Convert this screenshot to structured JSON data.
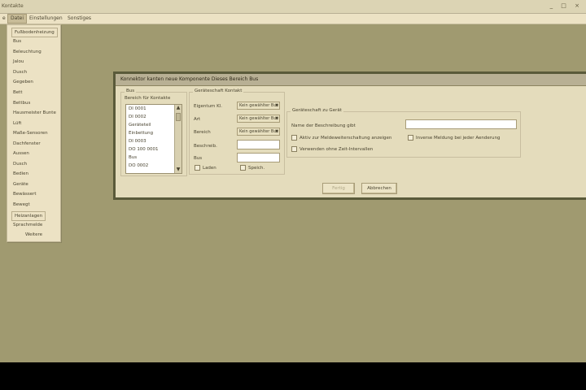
{
  "window": {
    "title": "Kontakte",
    "controls": "_ □ ×"
  },
  "menubar": {
    "items": [
      {
        "label": "e",
        "active": false
      },
      {
        "label": "Datei",
        "active": true
      },
      {
        "label": "Einstellungen",
        "active": false
      },
      {
        "label": "Sonstiges",
        "active": false
      }
    ]
  },
  "dropdown": {
    "items": [
      "Fußbodenheizung",
      "Bus",
      "Beleuchtung",
      "Jalou",
      "Dusch",
      "Gegeben",
      "Bett",
      "Bettbus",
      "Hausmeister Bunte",
      "Lüft",
      "Maße-Sensoren",
      "Dachfenster",
      "Aussen",
      "Dusch",
      "Bedien",
      "Geräte",
      "Bewässert",
      "Bewegt",
      "Heizanlagen",
      "Sprachmelde"
    ],
    "more_label": "Weitere"
  },
  "dialog": {
    "title": "Konnektor kanten neue Komponente Dieses Bereich Bus",
    "list_group": {
      "label": "Bus",
      "sublabel": "Bereich für Kontakte",
      "items": [
        "DI 0001",
        "DI 0002",
        "Geräteteil",
        "Einbettung",
        "DI 0003",
        "DO 100 0001",
        "Bus",
        "DO 0002"
      ]
    },
    "prop_group": {
      "label": "Geräteschaft Kontakt",
      "rows": [
        {
          "label": "Eigentum Kl.",
          "value": "Kein gewählter Bus"
        },
        {
          "label": "Art",
          "value": "Kein gewählter Bus"
        },
        {
          "label": "Bereich",
          "value": "Kein gewählter Bus"
        },
        {
          "label": "Beschreib.",
          "value": ""
        },
        {
          "label": "Bus",
          "value": ""
        }
      ],
      "btn_left": "Laden",
      "btn_right": "Speich."
    },
    "extra_group": {
      "label": "Geräteschaft zu Gerät",
      "field_label": "Name der Beschreibung gibt",
      "field_value": "",
      "checks": [
        {
          "label": "Aktiv zur Meldeweiterschaltung anzeigen",
          "checked": false
        },
        {
          "label": "Verwenden ohne Zeit-Intervallen",
          "checked": false
        },
        {
          "label": "Inverse Meldung bei jeder Aenderung",
          "checked": false
        }
      ]
    },
    "buttons": {
      "ok": "Fertig",
      "cancel": "Abbrechen"
    }
  }
}
